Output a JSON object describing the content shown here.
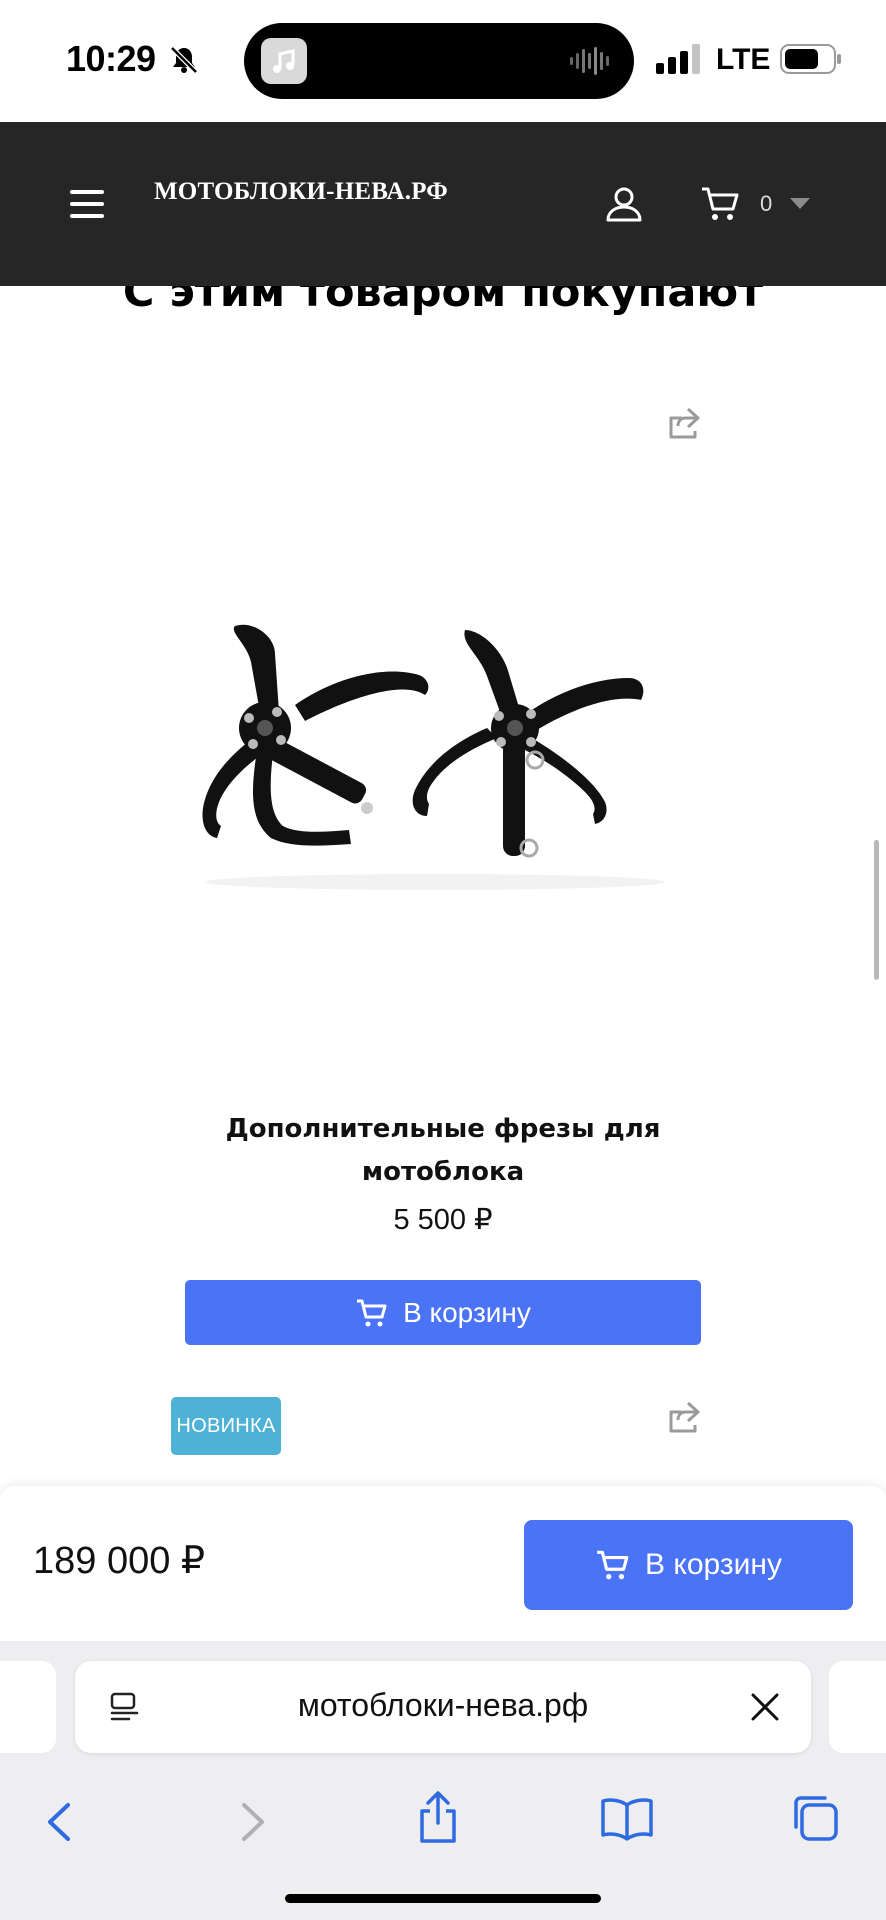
{
  "status_bar": {
    "time": "10:29",
    "network": "LTE",
    "icons": [
      "bell-slash-icon",
      "music-app-icon",
      "audio-wave-icon",
      "signal-icon",
      "battery-icon"
    ]
  },
  "header": {
    "logo": "МОТОБЛОКИ-НЕВА.РФ",
    "cart_count": "0",
    "icons": [
      "menu-icon",
      "user-icon",
      "cart-icon",
      "caret-down-icon"
    ]
  },
  "section": {
    "title": "С этим товаром покупают"
  },
  "product": {
    "name": "Дополнительные фрезы для мотоблока",
    "price": "5 500 ₽",
    "cart_button": "В корзину"
  },
  "next_product": {
    "badge": "НОВИНКА"
  },
  "buy_bar": {
    "price": "189 000 ₽",
    "cart_button": "В корзину"
  },
  "safari": {
    "url": "мотоблоки-нева.рф",
    "icons": [
      "reader-icon",
      "close-icon",
      "back-icon",
      "forward-icon",
      "share-icon",
      "bookmarks-icon",
      "tabs-icon"
    ]
  },
  "colors": {
    "header_bg": "#262626",
    "accent_blue": "#4a74f5",
    "badge_new": "#4fb1d6",
    "safari_bg": "#eeeef0"
  }
}
